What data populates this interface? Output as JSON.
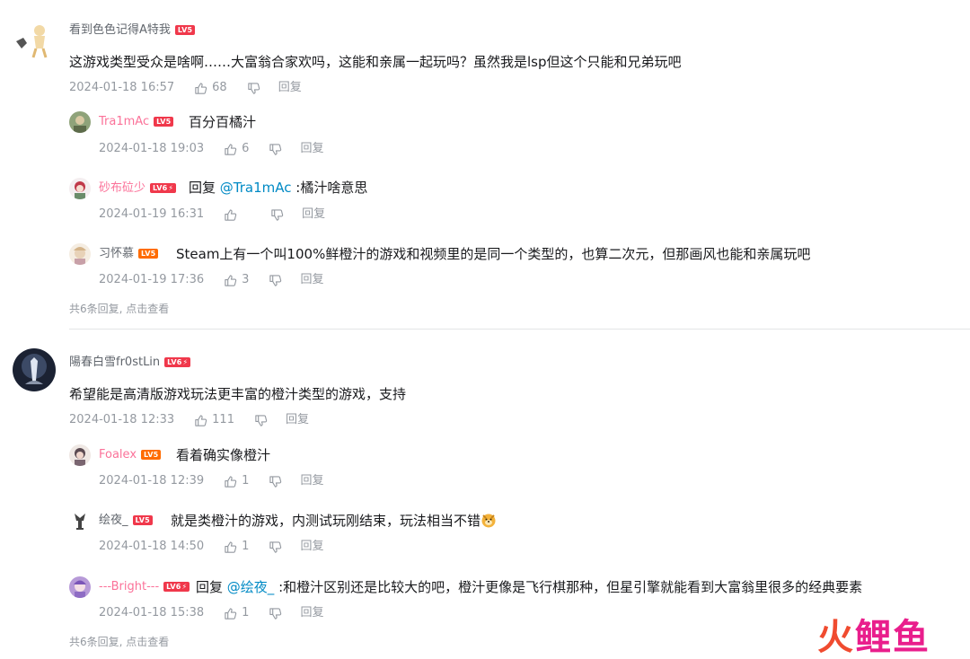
{
  "thread1": {
    "user": "看到色色记得A特我",
    "level": "LV5",
    "text": "这游戏类型受众是啥啊……大富翁合家欢吗，这能和亲属一起玩吗？虽然我是lsp但这个只能和兄弟玩吧",
    "time": "2024-01-18 16:57",
    "likes": "68",
    "reply_label": "回复",
    "replies": [
      {
        "user": "Tra1mAc",
        "level": "LV5",
        "text": "百分百橘汁",
        "time": "2024-01-18 19:03",
        "likes": "6",
        "reply_label": "回复"
      },
      {
        "user": "砂布砬少",
        "level": "LV6",
        "prefix": "回复 ",
        "mention": "@Tra1mAc",
        "text": " :橘汁啥意思",
        "time": "2024-01-19 16:31",
        "likes": "",
        "reply_label": "回复"
      },
      {
        "user": "习怀慕",
        "level": "LV5",
        "text": "Steam上有一个叫100%鲜橙汁的游戏和视频里的是同一个类型的，也算二次元，但那画风也能和亲属玩吧",
        "time": "2024-01-19 17:36",
        "likes": "3",
        "reply_label": "回复"
      }
    ],
    "more": "共6条回复, 点击查看"
  },
  "thread2": {
    "user": "陽春白雪fr0stLin",
    "level": "LV6",
    "text": "希望能是高清版游戏玩法更丰富的橙汁类型的游戏，支持",
    "time": "2024-01-18 12:33",
    "likes": "111",
    "reply_label": "回复",
    "replies": [
      {
        "user": "Foalex",
        "level": "LV5",
        "text": "看着确实像橙汁",
        "time": "2024-01-18 12:39",
        "likes": "1",
        "reply_label": "回复"
      },
      {
        "user": "绘夜_",
        "level": "LV5",
        "text": "就是类橙汁的游戏，内测试玩刚结束，玩法相当不错",
        "time": "2024-01-18 14:50",
        "likes": "1",
        "reply_label": "回复"
      },
      {
        "user": "---Bright---",
        "level": "LV6",
        "prefix": "回复 ",
        "mention": "@绘夜_",
        "text": " :和橙汁区别还是比较大的吧，橙汁更像是飞行棋那种，但星引擎就能看到大富翁里很多的经典要素",
        "time": "2024-01-18 15:38",
        "likes": "1",
        "reply_label": "回复"
      }
    ],
    "more": "共6条回复, 点击查看"
  },
  "watermark": {
    "part1": "火",
    "part2": "鲤鱼"
  },
  "icons": {
    "like": "thumb-up-icon",
    "dislike": "thumb-down-icon",
    "emoji": "doge-emoji-icon"
  },
  "colors": {
    "username_vip": "#fb7299",
    "mention": "#008ac5",
    "level_badge": "#f0384b",
    "meta": "#9499a0"
  }
}
